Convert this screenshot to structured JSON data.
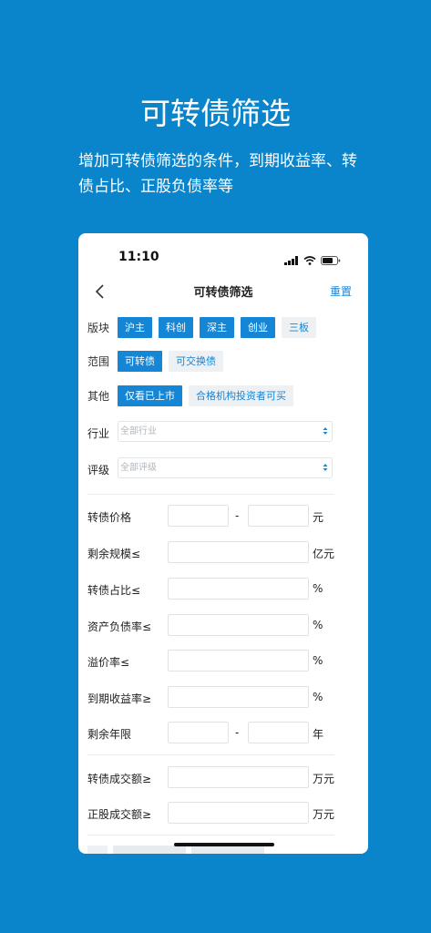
{
  "hero": {
    "title": "可转债筛选",
    "subtitle": "增加可转债筛选的条件，到期收益率、转债占比、正股负债率等"
  },
  "status_bar": {
    "time": "11:10"
  },
  "nav": {
    "title": "可转债筛选",
    "reset": "重置"
  },
  "filters": {
    "board": {
      "label": "版块",
      "options": [
        {
          "text": "沪主",
          "selected": true
        },
        {
          "text": "科创",
          "selected": true
        },
        {
          "text": "深主",
          "selected": true
        },
        {
          "text": "创业",
          "selected": true
        },
        {
          "text": "三板",
          "selected": false
        }
      ]
    },
    "scope": {
      "label": "范围",
      "options": [
        {
          "text": "可转债",
          "selected": true
        },
        {
          "text": "可交换债",
          "selected": false
        }
      ]
    },
    "other": {
      "label": "其他",
      "options": [
        {
          "text": "仅看已上市",
          "selected": true
        },
        {
          "text": "合格机构投资者可买",
          "selected": false
        }
      ]
    },
    "industry": {
      "label": "行业",
      "placeholder": "全部行业"
    },
    "rating": {
      "label": "评级",
      "placeholder": "全部评级"
    }
  },
  "fields": {
    "price": {
      "label": "转债价格",
      "dash": "-",
      "unit": "元"
    },
    "remaining_scale": {
      "label": "剩余规模≤",
      "unit": "亿元"
    },
    "bond_ratio": {
      "label": "转债占比≤",
      "unit": "%"
    },
    "debt_ratio": {
      "label": "资产负债率≤",
      "unit": "%"
    },
    "premium": {
      "label": "溢价率≤",
      "unit": "%"
    },
    "ytm": {
      "label": "到期收益率≥",
      "unit": "%"
    },
    "years": {
      "label": "剩余年限",
      "dash": "-",
      "unit": "年"
    },
    "bond_turnover": {
      "label": "转债成交额≥",
      "unit": "万元"
    },
    "stock_turnover": {
      "label": "正股成交额≥",
      "unit": "万元"
    }
  },
  "colors": {
    "background": "#0a85cc",
    "accent": "#1585d6",
    "chip_off_bg": "#eef1f4"
  }
}
